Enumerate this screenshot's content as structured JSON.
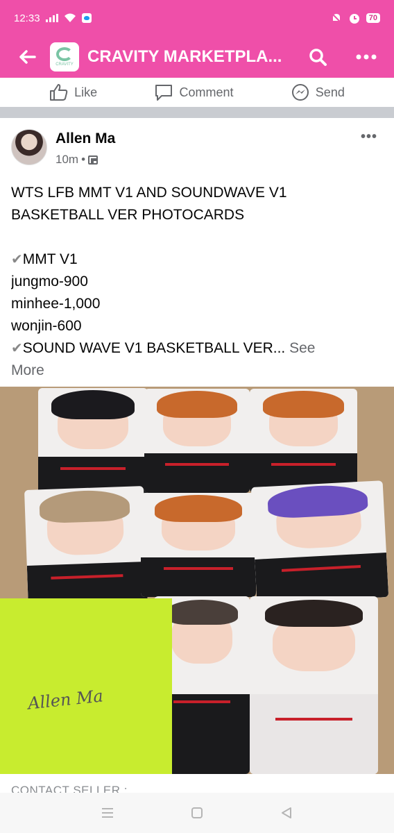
{
  "status_bar": {
    "time": "12:33",
    "battery": "70"
  },
  "app_bar": {
    "title": "CRAVITY MARKETPLA..."
  },
  "actions": {
    "like": "Like",
    "comment": "Comment",
    "send": "Send"
  },
  "post": {
    "author": "Allen Ma",
    "time": "10m",
    "text_lines": [
      "WTS LFB MMT V1 AND SOUNDWAVE V1",
      "BASKETBALL VER PHOTOCARDS",
      "MMT V1",
      "jungmo-900",
      "minhee-1,000",
      "wonjin-600",
      "SOUND WAVE V1 BASKETBALL VER...",
      "See",
      "More"
    ],
    "photo_note": "Allen Ma",
    "caption_peek": "CONTACT SELLER :"
  },
  "colors": {
    "accent": "#ef4fa9",
    "secondary_text": "#65676b"
  },
  "icons": [
    "signal-icon",
    "wifi-icon",
    "twitter-icon",
    "mute-icon",
    "alarm-icon",
    "back-arrow-icon",
    "search-icon",
    "more-icon",
    "like-icon",
    "comment-icon",
    "send-icon",
    "menu-icon",
    "home-icon",
    "back-icon"
  ]
}
